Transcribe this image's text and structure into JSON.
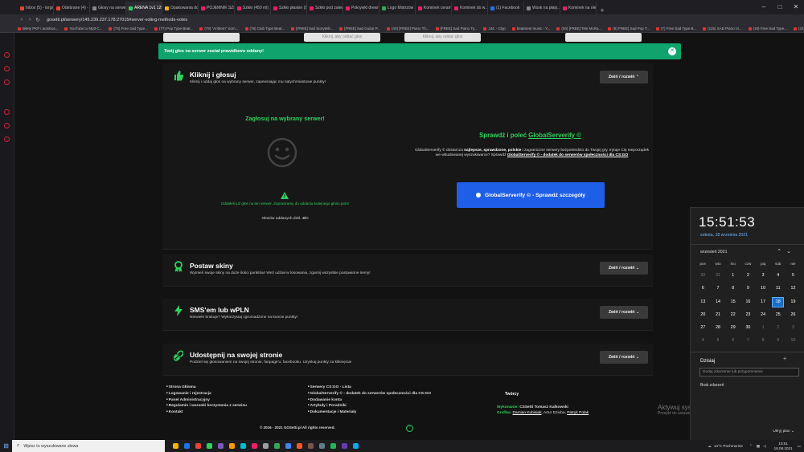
{
  "browser": {
    "tabs": [
      {
        "label": "Inbox (5) - lorgio",
        "color": "#ea4335"
      },
      {
        "label": "Odebrane (4) - l...",
        "color": "#ea4335"
      },
      {
        "label": "Głosy na serwer",
        "color": "#888888"
      },
      {
        "label": "ARENA 1v1 125 ...",
        "color": "#2ed15e",
        "active": true
      },
      {
        "label": "Opakowania do...",
        "color": "#f4b400"
      },
      {
        "label": "POJEMNIK SZKŁ...",
        "color": "#e91e63"
      },
      {
        "label": "Szkło (450 ml) ...",
        "color": "#e91e63"
      },
      {
        "label": "Szkło płaskie (1...",
        "color": "#e91e63"
      },
      {
        "label": "Szkło pod zalew...",
        "color": "#e91e63"
      },
      {
        "label": "Pokrywki drewn...",
        "color": "#e91e63"
      },
      {
        "label": "Logo Mistrzów 2...",
        "color": "#34a853"
      },
      {
        "label": "Kominek ceram...",
        "color": "#e91e63"
      },
      {
        "label": "Kominek do w...",
        "color": "#e91e63"
      },
      {
        "label": "(1) Facebook",
        "color": "#1877f2"
      },
      {
        "label": "Wosk na płaty...",
        "color": "#888888"
      },
      {
        "label": "Kominek na olej...",
        "color": "#e91e63"
      }
    ],
    "url": "gosetti.pl/serwery/145.239.237.178:27015#server-voting-methods-votes",
    "bookmarks": [
      "Bilety PKP i autobus...",
      "YouTube to Mp3 C...",
      "(73) Free Sad Type...",
      "(77) Pop Type Beat...",
      "(78) \"Anthem\" Som...",
      "(78) Club Type Beat...",
      "[FREE] Sad Storytelli...",
      "[FREE] Sad Guitar P...",
      "(40) [FREE] Piano Th...",
      "[FREE] Sad Piano Ty...",
      "JJ4. - Clyp",
      "beatmeni music - Y...",
      "(93) [FREE] Tele McRa...",
      "(5) FREE] Sad Pop T...",
      "(7) Free Sad Type B...",
      "(115) SAD Piano Vi...",
      "(18) Free Sad Type...",
      "(23) Beezzel - Prawo..."
    ]
  },
  "top_strip": {
    "btn1": "",
    "btn2": "Kliknij, aby oddać głos",
    "btn3": "Kliknij, aby oddać głos",
    "btn4": ""
  },
  "alert": {
    "text": "Twój głos na serwer został prawidłowo oddany!"
  },
  "sections": [
    {
      "title": "Kliknij i głosuj",
      "desc": "Kliknij i oddaj głos na wybrany serwer, zapewniając mu natychmiastowe punkty!",
      "toggle": "Zwiń / rozwiń"
    },
    {
      "title": "Postaw skiny",
      "desc": "Wymień swoje skiny na duże ilości punktów! Weź udział w losowaniu, zgarnij wszystkie postawione itemy!",
      "toggle": "Zwiń / rozwiń"
    },
    {
      "title": "SMS'em lub wPLN",
      "desc": "Niewiele brakuje? Wykorzystaj zgromadzone na koncie punkty!",
      "toggle": "Zwiń / rozwiń"
    },
    {
      "title": "Udostępnij na swojej stronie",
      "desc": "Podziel się głosowaniem na swojej stronie, fanpage'u, facebooku. Uzyskaj punkty za kliknięcia!",
      "toggle": "Zwiń / rozwiń"
    }
  ],
  "vote": {
    "heading": "Zagłosuj na wybrany serwer!",
    "message": "Oddałeś już głos na ten serwer. Zapraszamy do oddania kolejnego głosu jutro!",
    "count_label": "Głosów oddanych dziś:",
    "count_value": "4/∞"
  },
  "globalserverify": {
    "title_prefix": "Sprawdź i poleć",
    "title_link": "GlobalServerify ©",
    "text_1": "GlobalServerify © dostarcza",
    "text_bold": "najlepsze, sprawdzone, polskie",
    "text_2": "i zagraniczne serwery bezpośrednio do Twojej gry. Irytuje Cię nieporządek we wbudowanej wyszukiwarce? Sprawdź",
    "text_link": "GlobalServerify © - dodatek do serwerów społeczności dla CS:GO",
    "button": "GlobalServerify © - Sprawdź szczegóły"
  },
  "footer": {
    "col1": [
      "Strona Główna",
      "Logowanie i rejestracja",
      "Panel Administracyjny",
      "Regulamin i warunki korzystania z serwisu",
      "Kontakt"
    ],
    "col2": [
      "Serwery CS:GO - Lista",
      "GlobalServerify © - dodatek do serwerów społeczności dla CS:GO",
      "Dodawanie konta",
      "Artykuły i Poradniki",
      "Dokumentacje i Materiały"
    ],
    "creators": "Twórcy",
    "exec_label": "Wykonanie:",
    "exec_value": "CSSetti Tomasz Kalkowski",
    "graphics_label": "Grafika:",
    "graphics_1": "Damian Kubisiak",
    "graphics_2": "Artur Dziuba",
    "graphics_3": "Patryk Polak",
    "copyright": "© 2016 - 2021 GOSetti.pl All rights reserved."
  },
  "calendar": {
    "time": "15:51:53",
    "date": "sobota, 18 września 2021",
    "month": "wrzesień 2021",
    "dow": [
      "pon",
      "wto",
      "śro",
      "czw",
      "pią",
      "sob",
      "nie"
    ],
    "weeks": [
      [
        "30",
        "31",
        "1",
        "2",
        "3",
        "4",
        "5"
      ],
      [
        "6",
        "7",
        "8",
        "9",
        "10",
        "11",
        "12"
      ],
      [
        "13",
        "14",
        "15",
        "16",
        "17",
        "18",
        "19"
      ],
      [
        "20",
        "21",
        "22",
        "23",
        "24",
        "25",
        "26"
      ],
      [
        "27",
        "28",
        "29",
        "30",
        "1",
        "2",
        "3"
      ],
      [
        "4",
        "5",
        "6",
        "7",
        "8",
        "9",
        "10"
      ]
    ],
    "today": "18",
    "events_label": "Dzisiaj",
    "event_placeholder": "Dodaj zdarzenie lub przypomnienie",
    "no_events": "Brak zdarzeń",
    "hide": "Ukryj plan"
  },
  "activation": {
    "title": "Aktywuj system Windows",
    "subtitle": "Przejdź do ustawień, aby aktywować system Windows."
  },
  "taskbar": {
    "search_placeholder": "Wpisz tu wyszukiwane słowa",
    "weather": "14°C Pochmurnie",
    "clock_time": "15:51",
    "clock_date": "18.09.2021",
    "apps": [
      "#f4b400",
      "#1a73e8",
      "#ea4335",
      "#2ed15e",
      "#7e57c2",
      "#ff9800",
      "#00bcd4",
      "#e91e63",
      "#9e9e9e",
      "#34a853",
      "#4285f4",
      "#ff5722",
      "#795548",
      "#607d8b",
      "#1db954",
      "#673ab7",
      "#03a9f4"
    ]
  }
}
